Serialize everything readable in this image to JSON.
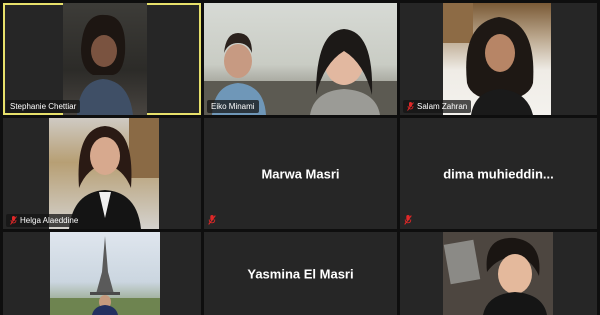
{
  "meeting": {
    "participants": [
      {
        "id": "p1",
        "name": "Stephanie Chettiar",
        "video": true,
        "muted": false,
        "active_speaker": true
      },
      {
        "id": "p2",
        "name": "Eiko Minami",
        "video": true,
        "muted": false,
        "active_speaker": false
      },
      {
        "id": "p3",
        "name": "Salam Zahran",
        "video": true,
        "muted": true,
        "active_speaker": false
      },
      {
        "id": "p4",
        "name": "Helga Alaeddine",
        "video": true,
        "muted": true,
        "active_speaker": false
      },
      {
        "id": "p5",
        "name": "Marwa Masri",
        "video": false,
        "muted": true,
        "active_speaker": false
      },
      {
        "id": "p6",
        "name": "dima  muhieddin...",
        "video": false,
        "muted": true,
        "active_speaker": false
      },
      {
        "id": "p7",
        "name": "",
        "video": true,
        "muted": false,
        "active_speaker": false
      },
      {
        "id": "p8",
        "name": "Yasmina El Masri",
        "video": false,
        "muted": false,
        "active_speaker": false
      },
      {
        "id": "p9",
        "name": "",
        "video": true,
        "muted": false,
        "active_speaker": false
      }
    ]
  },
  "colors": {
    "active_speaker_border": "#e7e06b",
    "tile_background": "#262626",
    "muted_icon": "#e02828"
  },
  "icons": {
    "muted": "microphone-muted-icon"
  }
}
